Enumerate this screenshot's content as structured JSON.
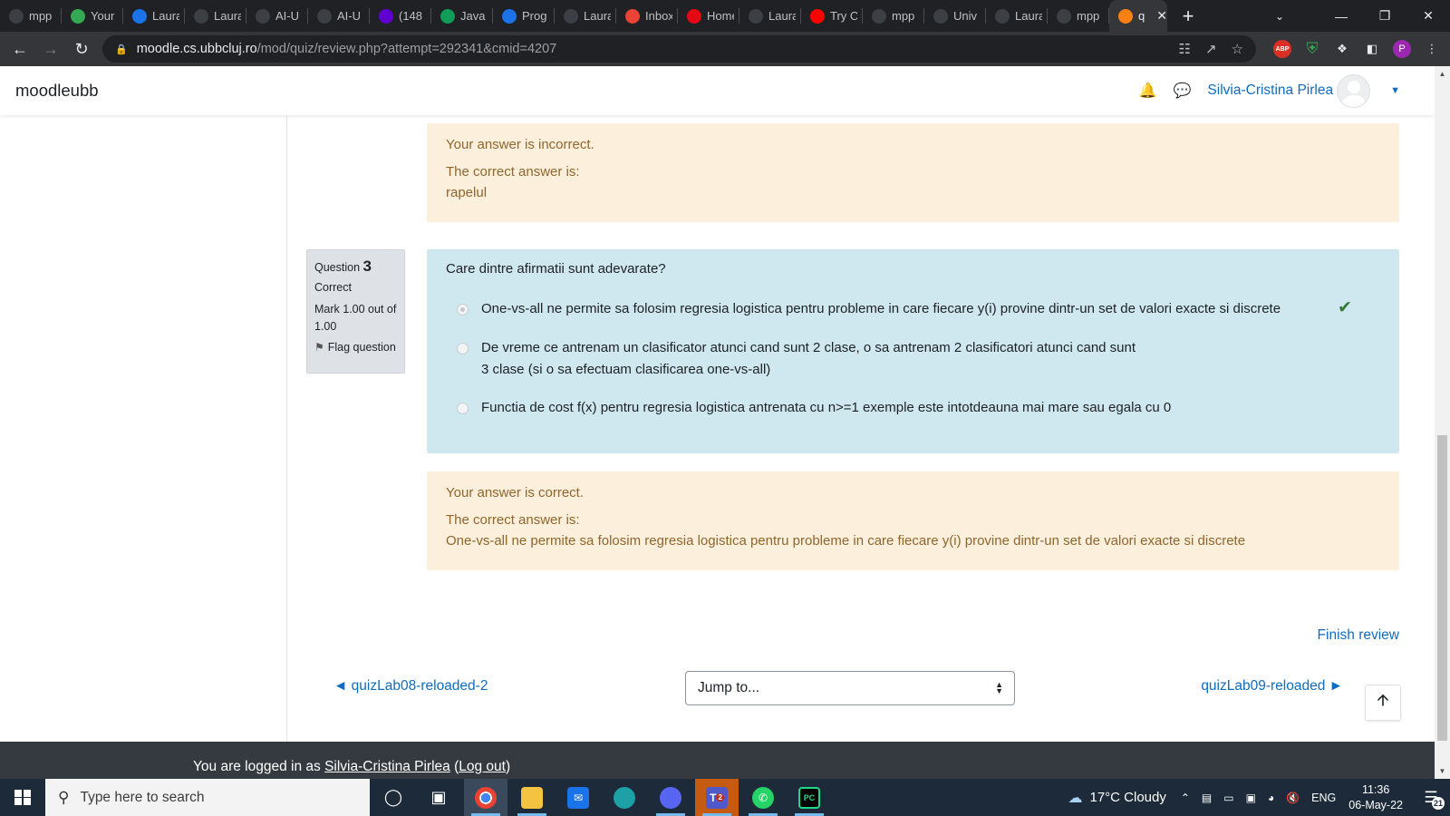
{
  "browser": {
    "tabs": [
      {
        "label": "mpp",
        "icon": "github-icon",
        "color": "#3c3f44"
      },
      {
        "label": "Your",
        "icon": "leaf-icon",
        "color": "#34a853"
      },
      {
        "label": "Laura",
        "icon": "globe-icon",
        "color": "#1a73e8"
      },
      {
        "label": "Laura",
        "icon": "github-icon",
        "color": "#3c3f44"
      },
      {
        "label": "AI-U",
        "icon": "github-icon",
        "color": "#3c3f44"
      },
      {
        "label": "AI-U",
        "icon": "github-icon",
        "color": "#3c3f44"
      },
      {
        "label": "(148",
        "icon": "yahoo-icon",
        "color": "#6001d2"
      },
      {
        "label": "Java",
        "icon": "w-icon",
        "color": "#0f9d58"
      },
      {
        "label": "Prog",
        "icon": "globe-icon",
        "color": "#1a73e8"
      },
      {
        "label": "Laura",
        "icon": "github-icon",
        "color": "#3c3f44"
      },
      {
        "label": "Inbox",
        "icon": "gmail-icon",
        "color": "#ea4335"
      },
      {
        "label": "Home",
        "icon": "netflix-icon",
        "color": "#e50914"
      },
      {
        "label": "Laura",
        "icon": "github-icon",
        "color": "#3c3f44"
      },
      {
        "label": "Try C",
        "icon": "youtube-icon",
        "color": "#ff0000"
      },
      {
        "label": "mpp",
        "icon": "github-icon",
        "color": "#3c3f44"
      },
      {
        "label": "Univ",
        "icon": "github-icon",
        "color": "#3c3f44"
      },
      {
        "label": "Laura",
        "icon": "github-icon",
        "color": "#3c3f44"
      },
      {
        "label": "mpp",
        "icon": "github-icon",
        "color": "#3c3f44"
      },
      {
        "label": "q",
        "icon": "moodle-icon",
        "color": "#f98012",
        "active": true
      }
    ],
    "url_host": "moodle.cs.ubbcluj.ro",
    "url_path": "/mod/quiz/review.php?attempt=292341&cmid=4207",
    "profile_initial": "P",
    "abp_label": "ABP"
  },
  "moodle": {
    "brand": "moodleubb",
    "user_name": "Silvia-Cristina Pirlea"
  },
  "question2_outcome": {
    "status": "Your answer is incorrect.",
    "correct_label": "The correct answer is:",
    "correct_value": "rapelul"
  },
  "question3": {
    "label": "Question",
    "number": "3",
    "state": "Correct",
    "grade": "Mark 1.00 out of 1.00",
    "flag_label": "Flag question",
    "text": "Care dintre afirmatii sunt adevarate?",
    "options": [
      {
        "text": "One-vs-all ne permite sa folosim regresia logistica pentru probleme in care fiecare y(i) provine dintr-un set de valori exacte si discrete",
        "checked": true
      },
      {
        "text": "De vreme ce antrenam un clasificator atunci cand sunt 2 clase, o sa antrenam 2 clasificatori atunci cand sunt 3 clase (si o sa efectuam clasificarea one-vs-all)",
        "checked": false
      },
      {
        "text": "Functia de cost f(x) pentru regresia logistica antrenata cu n>=1 exemple este intotdeauna mai mare sau egala cu 0",
        "checked": false
      }
    ],
    "outcome_status": "Your answer is correct.",
    "correct_label": "The correct answer is:",
    "correct_value": "One-vs-all ne permite sa folosim regresia logistica pentru probleme in care fiecare y(i) provine dintr-un set de valori exacte si discrete"
  },
  "navigation": {
    "finish_review": "Finish review",
    "prev_link": "◄ quizLab08-reloaded-2",
    "jump_to": "Jump to...",
    "next_link": "quizLab09-reloaded ►"
  },
  "footer": {
    "prefix": "You are logged in as ",
    "user_link": "Silvia-Cristina Pirlea",
    "open_paren": " (",
    "logout_link": "Log out",
    "close_paren": ")"
  },
  "taskbar": {
    "search_placeholder": "Type here to search",
    "weather": "17°C  Cloudy",
    "language": "ENG",
    "time": "11:36",
    "date": "06-May-22",
    "notifications": "21",
    "teams_badge": "2"
  },
  "colors": {
    "link": "#0f6cbf",
    "outcome_bg": "#fcefdc",
    "outcome_text": "#8e662e",
    "formulation_bg": "#cfe8ef",
    "correct_tick": "#357a32"
  }
}
